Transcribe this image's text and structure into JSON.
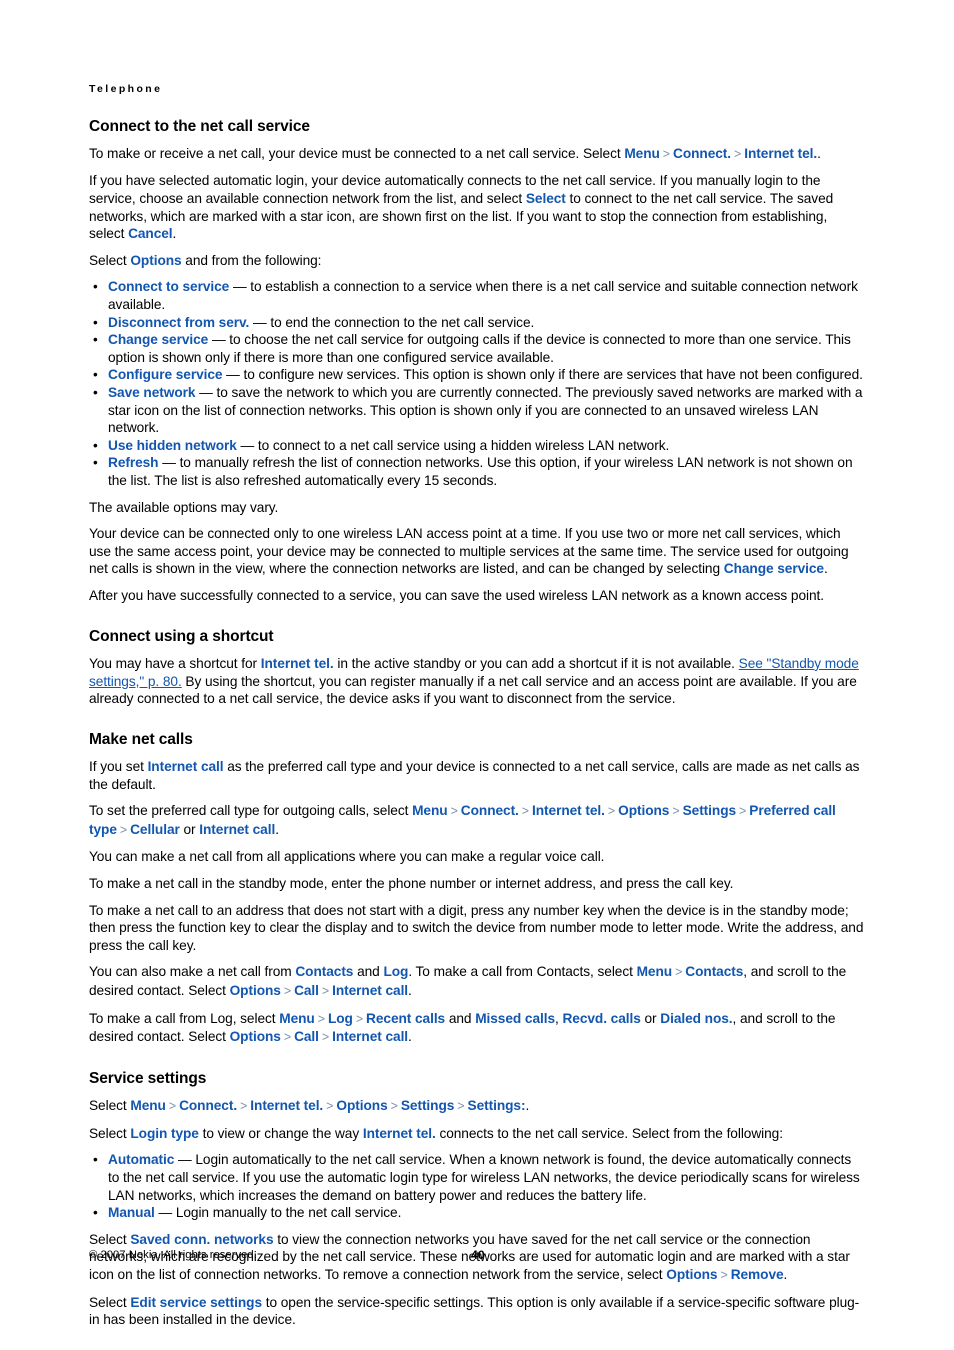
{
  "running_head": "Telephone",
  "colors": {
    "link": "#1256b0",
    "separator": "#7a8fa8",
    "text": "#000000",
    "background": "#ffffff"
  },
  "sections": [
    {
      "heading": "Connect to the net call service",
      "paragraphs": [
        {
          "id": "p1",
          "runs": [
            {
              "t": "To make or receive a net call, your device must be connected to a net call service. Select ",
              "k": "plain"
            },
            {
              "t": "Menu",
              "k": "link"
            },
            {
              "t": ">",
              "k": "sep"
            },
            {
              "t": "Connect.",
              "k": "link"
            },
            {
              "t": ">",
              "k": "sep"
            },
            {
              "t": "Internet tel.",
              "k": "link"
            },
            {
              "t": ".",
              "k": "plain"
            }
          ]
        },
        {
          "id": "p2",
          "runs": [
            {
              "t": "If you have selected automatic login, your device automatically connects to the net call service. If you manually login to the service, choose an available connection network from the list, and select ",
              "k": "plain"
            },
            {
              "t": "Select",
              "k": "link"
            },
            {
              "t": " to connect to the net call service. The saved networks, which are marked with a star icon, are shown first on the list. If you want to stop the connection from establishing, select ",
              "k": "plain"
            },
            {
              "t": "Cancel",
              "k": "link"
            },
            {
              "t": ".",
              "k": "plain"
            }
          ]
        },
        {
          "id": "p3",
          "runs": [
            {
              "t": "Select ",
              "k": "plain"
            },
            {
              "t": "Options",
              "k": "link"
            },
            {
              "t": " and from the following:",
              "k": "plain"
            }
          ]
        }
      ],
      "bullets": [
        {
          "runs": [
            {
              "t": "Connect to service",
              "k": "link"
            },
            {
              "t": "  — to establish a connection to a service when there is a net call service and suitable connection network available.",
              "k": "plain"
            }
          ]
        },
        {
          "runs": [
            {
              "t": "Disconnect from serv.",
              "k": "link"
            },
            {
              "t": " — to end the connection to the net call service.",
              "k": "plain"
            }
          ]
        },
        {
          "runs": [
            {
              "t": "Change service",
              "k": "link"
            },
            {
              "t": " — to choose the net call service for outgoing calls if the device is connected to more than one service. This option is shown only if there is more than one configured service available.",
              "k": "plain"
            }
          ]
        },
        {
          "runs": [
            {
              "t": "Configure service",
              "k": "link"
            },
            {
              "t": " — to configure new services. This option is shown only if there are services that have not been configured.",
              "k": "plain"
            }
          ]
        },
        {
          "runs": [
            {
              "t": "Save network",
              "k": "link"
            },
            {
              "t": " — to save the network to which you are currently connected. The previously saved networks are marked with a star icon on the list of connection networks. This option is shown only if you are connected to an unsaved wireless LAN network.",
              "k": "plain"
            }
          ]
        },
        {
          "runs": [
            {
              "t": "Use hidden network",
              "k": "link"
            },
            {
              "t": " — to connect to a net call service using a hidden wireless LAN network.",
              "k": "plain"
            }
          ]
        },
        {
          "runs": [
            {
              "t": "Refresh",
              "k": "link"
            },
            {
              "t": " — to manually refresh the list of connection networks. Use this option, if your wireless LAN network is not shown on the list. The list is also refreshed automatically every 15 seconds.",
              "k": "plain"
            }
          ]
        }
      ],
      "paragraphs_after": [
        {
          "id": "p4",
          "runs": [
            {
              "t": "The available options may vary.",
              "k": "plain"
            }
          ]
        },
        {
          "id": "p5",
          "runs": [
            {
              "t": "Your device can be connected only to one wireless LAN access point at a time. If you use two or more net call services, which use the same access point, your device may be connected to multiple services at the same time. The service used for outgoing net calls is shown in the view, where the connection networks are listed, and can be changed by selecting ",
              "k": "plain"
            },
            {
              "t": "Change service",
              "k": "link"
            },
            {
              "t": ".",
              "k": "plain"
            }
          ]
        },
        {
          "id": "p6",
          "runs": [
            {
              "t": "After you have successfully connected to a service, you can save the used wireless LAN network as a known access point.",
              "k": "plain"
            }
          ]
        }
      ]
    },
    {
      "heading": "Connect using a shortcut",
      "paragraphs": [
        {
          "id": "p7",
          "runs": [
            {
              "t": "You may have a shortcut for ",
              "k": "plain"
            },
            {
              "t": "Internet tel.",
              "k": "link"
            },
            {
              "t": " in the active standby or you can add a shortcut if it is not available. ",
              "k": "plain"
            },
            {
              "t": "See \"Standby mode settings,\" p. 80.",
              "k": "link-underline"
            },
            {
              "t": " By using the shortcut, you can register manually if a net call service and an access point are available. If you are already connected to a net call service, the device asks if you want to disconnect from the service.",
              "k": "plain"
            }
          ]
        }
      ]
    },
    {
      "heading": "Make net calls",
      "paragraphs": [
        {
          "id": "p8",
          "runs": [
            {
              "t": "If you set ",
              "k": "plain"
            },
            {
              "t": "Internet call",
              "k": "link"
            },
            {
              "t": " as the preferred call type and your device is connected to a net call service, calls are made as net calls as the default.",
              "k": "plain"
            }
          ]
        },
        {
          "id": "p9",
          "runs": [
            {
              "t": "To set the preferred call type for outgoing calls, select ",
              "k": "plain"
            },
            {
              "t": "Menu",
              "k": "link"
            },
            {
              "t": ">",
              "k": "sep"
            },
            {
              "t": "Connect.",
              "k": "link"
            },
            {
              "t": ">",
              "k": "sep"
            },
            {
              "t": "Internet tel.",
              "k": "link"
            },
            {
              "t": ">",
              "k": "sep"
            },
            {
              "t": "Options",
              "k": "link"
            },
            {
              "t": ">",
              "k": "sep"
            },
            {
              "t": "Settings",
              "k": "link"
            },
            {
              "t": ">",
              "k": "sep"
            },
            {
              "t": "Preferred call type",
              "k": "link"
            },
            {
              "t": ">",
              "k": "sep"
            },
            {
              "t": "Cellular",
              "k": "link"
            },
            {
              "t": " or ",
              "k": "plain"
            },
            {
              "t": "Internet call",
              "k": "link"
            },
            {
              "t": ".",
              "k": "plain"
            }
          ]
        },
        {
          "id": "p10",
          "runs": [
            {
              "t": "You can make a net call from all applications where you can make a regular voice call.",
              "k": "plain"
            }
          ]
        },
        {
          "id": "p11",
          "runs": [
            {
              "t": "To make a net call in the standby mode, enter the phone number or internet address, and press the call key.",
              "k": "plain"
            }
          ]
        },
        {
          "id": "p12",
          "runs": [
            {
              "t": "To make a net call to an address that does not start with a digit, press any number key when the device is in the standby mode; then press the function key to clear the display and to switch the device from number mode to letter mode. Write the address, and press the call key.",
              "k": "plain"
            }
          ]
        },
        {
          "id": "p13",
          "runs": [
            {
              "t": "You can also make a net call from ",
              "k": "plain"
            },
            {
              "t": "Contacts",
              "k": "link"
            },
            {
              "t": " and ",
              "k": "plain"
            },
            {
              "t": "Log",
              "k": "link"
            },
            {
              "t": ". To make a call from Contacts, select ",
              "k": "plain"
            },
            {
              "t": "Menu",
              "k": "link"
            },
            {
              "t": ">",
              "k": "sep"
            },
            {
              "t": "Contacts",
              "k": "link"
            },
            {
              "t": ", and scroll to the desired contact. Select ",
              "k": "plain"
            },
            {
              "t": "Options",
              "k": "link"
            },
            {
              "t": ">",
              "k": "sep"
            },
            {
              "t": "Call",
              "k": "link"
            },
            {
              "t": ">",
              "k": "sep"
            },
            {
              "t": "Internet call",
              "k": "link"
            },
            {
              "t": ".",
              "k": "plain"
            }
          ]
        },
        {
          "id": "p14",
          "runs": [
            {
              "t": "To make a call from Log, select ",
              "k": "plain"
            },
            {
              "t": "Menu",
              "k": "link"
            },
            {
              "t": ">",
              "k": "sep"
            },
            {
              "t": "Log",
              "k": "link"
            },
            {
              "t": ">",
              "k": "sep"
            },
            {
              "t": "Recent calls",
              "k": "link"
            },
            {
              "t": " and ",
              "k": "plain"
            },
            {
              "t": "Missed calls",
              "k": "link"
            },
            {
              "t": ", ",
              "k": "plain"
            },
            {
              "t": "Recvd. calls",
              "k": "link"
            },
            {
              "t": " or ",
              "k": "plain"
            },
            {
              "t": "Dialed nos.",
              "k": "link"
            },
            {
              "t": ", and scroll to the desired contact. Select ",
              "k": "plain"
            },
            {
              "t": "Options",
              "k": "link"
            },
            {
              "t": ">",
              "k": "sep"
            },
            {
              "t": "Call",
              "k": "link"
            },
            {
              "t": ">",
              "k": "sep"
            },
            {
              "t": "Internet call",
              "k": "link"
            },
            {
              "t": ".",
              "k": "plain"
            }
          ]
        }
      ]
    },
    {
      "heading": "Service settings",
      "paragraphs": [
        {
          "id": "p15",
          "runs": [
            {
              "t": "Select ",
              "k": "plain"
            },
            {
              "t": "Menu",
              "k": "link"
            },
            {
              "t": ">",
              "k": "sep"
            },
            {
              "t": "Connect.",
              "k": "link"
            },
            {
              "t": ">",
              "k": "sep"
            },
            {
              "t": "Internet tel.",
              "k": "link"
            },
            {
              "t": ">",
              "k": "sep"
            },
            {
              "t": "Options",
              "k": "link"
            },
            {
              "t": ">",
              "k": "sep"
            },
            {
              "t": "Settings",
              "k": "link"
            },
            {
              "t": ">",
              "k": "sep"
            },
            {
              "t": "Settings:",
              "k": "link"
            },
            {
              "t": ".",
              "k": "plain"
            }
          ]
        },
        {
          "id": "p16",
          "runs": [
            {
              "t": "Select ",
              "k": "plain"
            },
            {
              "t": "Login type",
              "k": "link"
            },
            {
              "t": " to view or change the way ",
              "k": "plain"
            },
            {
              "t": "Internet tel.",
              "k": "link"
            },
            {
              "t": " connects to the net call service. Select from the following:",
              "k": "plain"
            }
          ]
        }
      ],
      "bullets": [
        {
          "runs": [
            {
              "t": "Automatic",
              "k": "link"
            },
            {
              "t": " — Login automatically to the net call service. When a known network is found, the device automatically connects to the net call service. If you use the automatic login type for wireless LAN networks, the device periodically scans for wireless LAN networks, which increases the demand on battery power and reduces the battery life.",
              "k": "plain"
            }
          ]
        },
        {
          "runs": [
            {
              "t": "Manual",
              "k": "link"
            },
            {
              "t": " —  Login manually to the net call service.",
              "k": "plain"
            }
          ]
        }
      ],
      "paragraphs_after": [
        {
          "id": "p17",
          "runs": [
            {
              "t": "Select ",
              "k": "plain"
            },
            {
              "t": "Saved conn. networks",
              "k": "link"
            },
            {
              "t": " to view the connection networks you have saved for the net call service or the connection networks, which are recognized by the net call service. These networks are used for automatic login and are marked with a star icon on the list of connection networks. To remove a connection network from the service, select ",
              "k": "plain"
            },
            {
              "t": "Options",
              "k": "link"
            },
            {
              "t": ">",
              "k": "sep"
            },
            {
              "t": "Remove",
              "k": "link"
            },
            {
              "t": ".",
              "k": "plain"
            }
          ]
        },
        {
          "id": "p18",
          "runs": [
            {
              "t": "Select ",
              "k": "plain"
            },
            {
              "t": "Edit service settings",
              "k": "link"
            },
            {
              "t": " to open the service-specific settings. This option is only available if a service-specific software plug-in has been installed in the device.",
              "k": "plain"
            }
          ]
        }
      ]
    }
  ],
  "footer": {
    "copyright": "© 2007 Nokia. All rights reserved.",
    "page_number": "40"
  }
}
